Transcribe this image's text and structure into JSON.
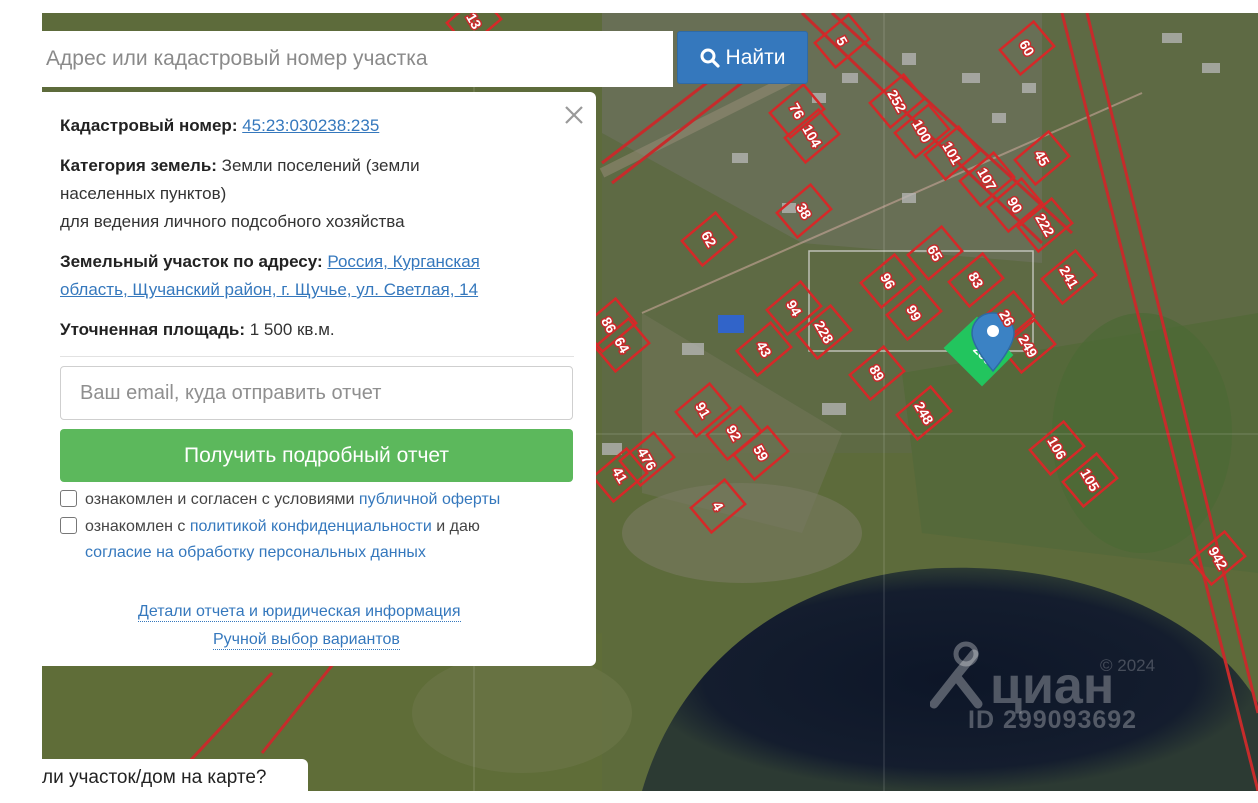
{
  "search": {
    "placeholder": "Адрес или кадастровый номер участка",
    "button_label": "Найти"
  },
  "info_panel": {
    "cadastral_label": "Кадастровый номер:",
    "cadastral_value": "45:23:030238:235",
    "category_label": "Категория земель:",
    "category_value_1": "Земли поселений (земли",
    "category_value_2": "населенных пунктов)",
    "category_value_3": "для ведения личного подсобного хозяйства",
    "address_label": "Земельный участок по адресу:",
    "address_value_1": "Россия, Курганская",
    "address_value_2": "область, Щучанский район, г. Щучье, ул. Светлая, 14",
    "area_label": "Уточненная площадь:",
    "area_value": "1 500 кв.м.",
    "email_placeholder": "Ваш email, куда отправить отчет",
    "report_button": "Получить подробный отчет",
    "consent1_text": "ознакомлен и согласен с условиями",
    "consent1_link": "публичной оферты",
    "consent2_text": "ознакомлен с",
    "consent2_link": "политикой конфиденциальности",
    "consent2_text_after": "и даю",
    "consent2_link_2": "согласие на обработку персональных данных",
    "details_link": "Детали отчета и юридическая информация",
    "manual_link": "Ручной выбор вариантов"
  },
  "bottom_tab": "ли участок/дом на карте?",
  "watermark": {
    "brand": "циан",
    "id": "ID 299093692",
    "year": "© 2024"
  },
  "map": {
    "parcel_labels": [
      "13",
      "5",
      "60",
      "76",
      "104",
      "252",
      "100",
      "101",
      "45",
      "107",
      "90",
      "222",
      "38",
      "62",
      "65",
      "83",
      "241",
      "96",
      "99",
      "94",
      "228",
      "43",
      "26",
      "249",
      "235",
      "89",
      "86",
      "64",
      "248",
      "91",
      "92",
      "59",
      "106",
      "105",
      "476",
      "41",
      "4",
      "942"
    ],
    "highlighted_parcel": "235"
  },
  "colors": {
    "accent_blue": "#3578bd",
    "report_green": "#5cb85c",
    "parcel_border": "#d62828",
    "highlight_parcel": "#22c55e",
    "pin": "#3b82c4"
  },
  "icons": [
    "search-icon",
    "close-icon",
    "map-pin-icon",
    "cian-logo-icon"
  ]
}
